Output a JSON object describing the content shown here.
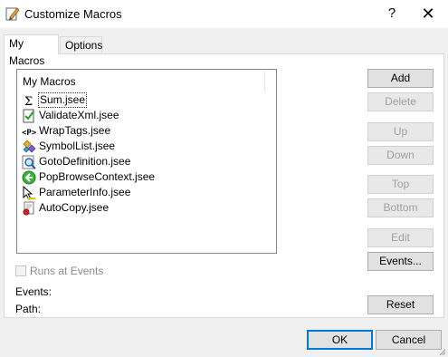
{
  "window": {
    "title": "Customize Macros",
    "help_label": "?",
    "close_label": "✕"
  },
  "tabs": [
    {
      "label": "My Macros",
      "active": true
    },
    {
      "label": "Options",
      "active": false
    }
  ],
  "macro_list": {
    "header": "My Macros",
    "items": [
      {
        "label": "Sum.jsee",
        "icon": "sigma-icon",
        "selected": true
      },
      {
        "label": "ValidateXml.jsee",
        "icon": "validate-check-icon",
        "selected": false
      },
      {
        "label": "WrapTags.jsee",
        "icon": "tag-brackets-icon",
        "selected": false
      },
      {
        "label": "SymbolList.jsee",
        "icon": "symbol-list-icon",
        "selected": false
      },
      {
        "label": "GotoDefinition.jsee",
        "icon": "magnifier-icon",
        "selected": false
      },
      {
        "label": "PopBrowseContext.jsee",
        "icon": "back-arrow-icon",
        "selected": false
      },
      {
        "label": "ParameterInfo.jsee",
        "icon": "parameter-info-icon",
        "selected": false
      },
      {
        "label": "AutoCopy.jsee",
        "icon": "copy-document-icon",
        "selected": false
      }
    ]
  },
  "side_buttons": {
    "add": "Add",
    "delete": "Delete",
    "up": "Up",
    "down": "Down",
    "top": "Top",
    "bottom": "Bottom",
    "edit": "Edit",
    "events": "Events...",
    "reset": "Reset"
  },
  "options": {
    "runs_at_events_label": "Runs at Events",
    "runs_at_events_checked": false,
    "events_label": "Events:",
    "path_label": "Path:"
  },
  "footer": {
    "ok": "OK",
    "cancel": "Cancel"
  },
  "colors": {
    "accent": "#0078d7",
    "disabled_text": "#a0a0a0",
    "dialog_bg": "#f0f0f0"
  }
}
